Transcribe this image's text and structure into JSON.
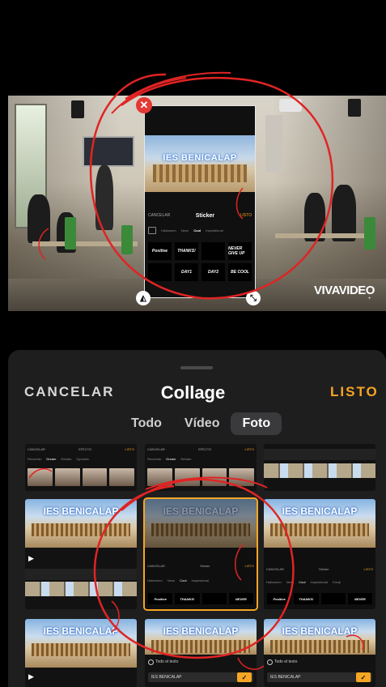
{
  "preview": {
    "close_glyph": "✕",
    "flip_glyph": "◭",
    "resize_glyph": "⤡",
    "watermark": "VIVAVIDEO",
    "watermark_sub": "+",
    "overlay": {
      "photo_title": "IES BENICALAP",
      "cancel": "CANCELAR",
      "title": "Sticker",
      "done": "LISTO",
      "tabs": [
        "Halloween",
        "Neon",
        "Cool",
        "Inspirational"
      ],
      "active_tab": "Cool",
      "stickers": [
        "Positive",
        "THANKS!",
        "",
        "NEVER GIVE UP",
        "",
        "DAY1",
        "DAY2",
        "BE COOL"
      ]
    }
  },
  "sheet": {
    "cancel_label": "CANCELAR",
    "title": "Collage",
    "done_label": "LISTO",
    "tabs": {
      "all": "Todo",
      "video": "Vídeo",
      "photo": "Foto"
    },
    "active_tab": "Foto"
  },
  "thumbs": {
    "effect_screen": {
      "cancel": "CANCELAR",
      "title": "EFECTO",
      "done": "LISTO",
      "tabs": [
        "Recuerdo",
        "Dream",
        "Retrato",
        "Dynamic"
      ],
      "active": "Dream"
    },
    "photo_title": "IES BENICALAP",
    "sticker_screen": {
      "cancel": "CANCELAR",
      "title": "Sticker",
      "done": "LISTO",
      "tabs": [
        "Halloween",
        "Neon",
        "Cool",
        "Inspirational",
        "Emoji"
      ],
      "active": "Cool",
      "stickers": [
        "Positive",
        "THANKS!",
        "",
        "NEVER"
      ]
    },
    "text_screen": {
      "radio_label": "Todo el texto",
      "input_value": "IES BENICALAP",
      "check_glyph": "✓"
    },
    "play_glyph": "▶"
  },
  "colors": {
    "accent": "#f6a623",
    "sheet_bg": "#1e1e1f",
    "scribble": "#e02424",
    "close_red": "#e53935"
  }
}
